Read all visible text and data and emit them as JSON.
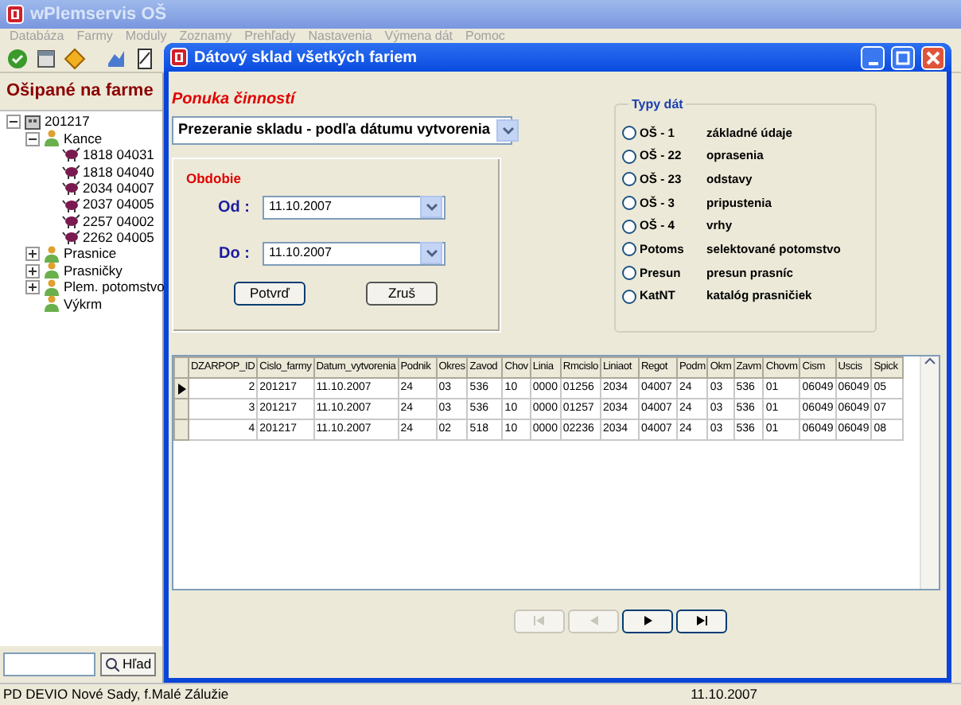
{
  "app": {
    "title": "wPlemservis OŠ",
    "menu": [
      "Databáza",
      "Farmy",
      "Moduly",
      "Zoznamy",
      "Prehľady",
      "Nastavenia",
      "Výmena dát",
      "Pomoc"
    ],
    "panel_title": "Ošipané na farme",
    "tree": [
      {
        "label": "201217",
        "kind": "farm",
        "expanded": true,
        "children": [
          {
            "label": "Kance",
            "kind": "group",
            "expanded": true,
            "children": [
              {
                "label": "1818 04031",
                "kind": "pig"
              },
              {
                "label": "1818 04040",
                "kind": "pig"
              },
              {
                "label": "2034 04007",
                "kind": "pig"
              },
              {
                "label": "2037 04005",
                "kind": "pig"
              },
              {
                "label": "2257 04002",
                "kind": "pig"
              },
              {
                "label": "2262 04005",
                "kind": "pig"
              }
            ]
          },
          {
            "label": "Prasnice",
            "kind": "group",
            "expanded": false
          },
          {
            "label": "Prasničky",
            "kind": "group",
            "expanded": false
          },
          {
            "label": "Plem. potomstvo",
            "kind": "group",
            "expanded": false
          },
          {
            "label": "Výkrm",
            "kind": "group"
          }
        ]
      }
    ],
    "search_button": "Hľad",
    "status_bar": [
      "PD DEVIO Nové Sady,  f.Malé Zálužie",
      "11.10.2007"
    ]
  },
  "dialog": {
    "title": "Dátový sklad všetkých fariem",
    "activity_label": "Ponuka činností",
    "activity_value": "Prezeranie skladu - podľa dátumu vytvorenia",
    "period": {
      "title": "Obdobie",
      "from_label": "Od :",
      "from_value": "11.10.2007",
      "to_label": "Do :",
      "to_value": "11.10.2007",
      "confirm": "Potvrď",
      "cancel": "Zruš"
    },
    "data_types": {
      "title": "Typy dát",
      "options": [
        {
          "code": "OŠ - 1",
          "description": "základné údaje",
          "selected": false
        },
        {
          "code": "OŠ - 22",
          "description": "oprasenia",
          "selected": false
        },
        {
          "code": "OŠ - 23",
          "description": "odstavy",
          "selected": false
        },
        {
          "code": "OŠ - 3",
          "description": "pripustenia",
          "selected": false
        },
        {
          "code": "OŠ - 4",
          "description": "vrhy",
          "selected": false
        },
        {
          "code": "Potoms",
          "description": "selektované potomstvo",
          "selected": false
        },
        {
          "code": "Presun",
          "description": "presun prasníc",
          "selected": false
        },
        {
          "code": "KatNT",
          "description": "katalóg prasničiek",
          "selected": false
        }
      ]
    },
    "table": {
      "columns": [
        "DZARPOP_ID",
        "Cislo_farmy",
        "Datum_vytvorenia",
        "Podnik",
        "Okres",
        "Zavod",
        "Chov",
        "Linia",
        "Rmcislo",
        "Liniaot",
        "Regot",
        "Podm",
        "Okm",
        "Zavm",
        "Chovm",
        "Cism",
        "Uscis",
        "Spick"
      ],
      "rows": [
        {
          "selected": true,
          "cells": [
            "2",
            "201217",
            "11.10.2007",
            "24",
            "03",
            "536",
            "10",
            "0000",
            "01256",
            "2034",
            "04007",
            "24",
            "03",
            "536",
            "01",
            "06049",
            "06049",
            "05"
          ]
        },
        {
          "selected": false,
          "cells": [
            "3",
            "201217",
            "11.10.2007",
            "24",
            "03",
            "536",
            "10",
            "0000",
            "01257",
            "2034",
            "04007",
            "24",
            "03",
            "536",
            "01",
            "06049",
            "06049",
            "07"
          ]
        },
        {
          "selected": false,
          "cells": [
            "4",
            "201217",
            "11.10.2007",
            "24",
            "02",
            "518",
            "10",
            "0000",
            "02236",
            "2034",
            "04007",
            "24",
            "03",
            "536",
            "01",
            "06049",
            "06049",
            "08"
          ]
        }
      ]
    },
    "navigation": [
      {
        "kind": "first",
        "disabled": true
      },
      {
        "kind": "prev",
        "disabled": true
      },
      {
        "kind": "next",
        "disabled": false
      },
      {
        "kind": "last",
        "disabled": false
      }
    ]
  }
}
